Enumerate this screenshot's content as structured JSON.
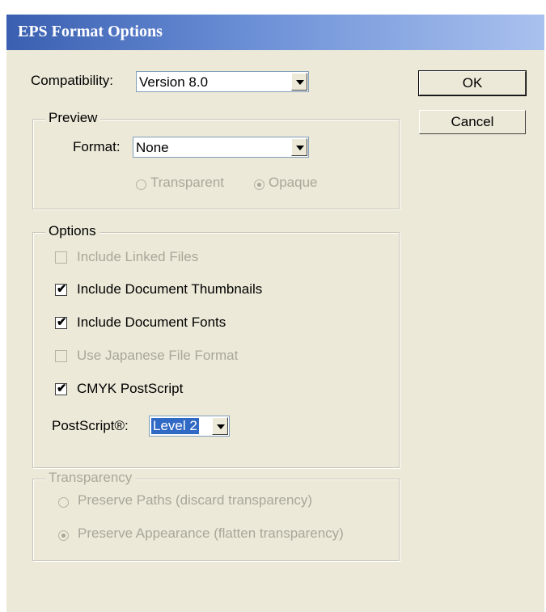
{
  "title": "EPS Format Options",
  "compatibility": {
    "label": "Compatibility:",
    "value": "Version 8.0"
  },
  "buttons": {
    "ok": "OK",
    "cancel": "Cancel"
  },
  "preview": {
    "legend": "Preview",
    "format_label": "Format:",
    "format_value": "None",
    "radio_transparent": "Transparent",
    "radio_opaque": "Opaque"
  },
  "options": {
    "legend": "Options",
    "include_linked_files": "Include Linked Files",
    "include_document_thumbnails": "Include Document Thumbnails",
    "include_document_fonts": "Include Document Fonts",
    "use_japanese_file_format": "Use Japanese File Format",
    "cmyk_postscript": "CMYK PostScript",
    "postscript_label": "PostScript®:",
    "postscript_value": "Level 2"
  },
  "transparency": {
    "legend": "Transparency",
    "preserve_paths": "Preserve Paths (discard transparency)",
    "preserve_appearance": "Preserve Appearance (flatten transparency)"
  }
}
